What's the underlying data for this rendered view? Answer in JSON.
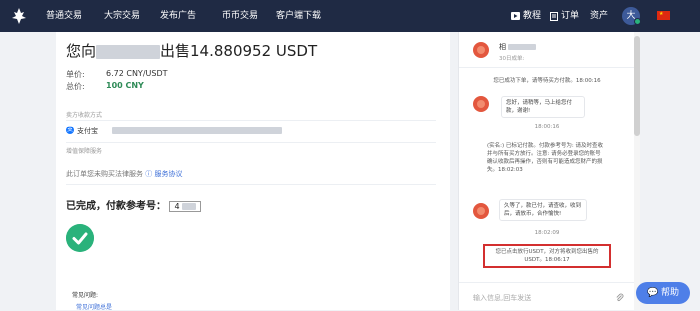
{
  "nav": {
    "items": [
      "普通交易",
      "大宗交易",
      "发布广告",
      "币币交易",
      "客户端下载"
    ],
    "right": {
      "tutorial": "教程",
      "orders": "订单",
      "assets": "资产"
    },
    "avatar_letter": "大",
    "accent": "#1f2a44"
  },
  "order": {
    "title_prefix": "您向",
    "title_suffix": "出售14.880952 USDT",
    "unit_price_label": "单价:",
    "unit_price_value": "6.72 CNY/USDT",
    "total_label": "总价:",
    "total_value": "100 CNY",
    "seller_payment_label": "卖方收款方式",
    "payment_method": "支付宝",
    "guarantee_label": "增值保障服务",
    "guarantee_text": "此订单您未购买法律服务",
    "service_agreement": "服务协议",
    "completed_label": "已完成，付款参考号：",
    "ref_number": "4",
    "faq_label": "常见问题:",
    "faq_link": "常见问题总是"
  },
  "chat": {
    "header_name": "相",
    "header_sub": "30日成单:",
    "msgs": [
      {
        "text": "您已成功下单，请等待买方付款。18:00:16"
      },
      {
        "text": "您好，请稍等，马上给您付款，谢谢!"
      },
      {
        "time": "18:00:16"
      },
      {
        "text": "(实名:) 已标记付款。付款参考号为: 请及时查收并与所有买方放行。注意: 请务必登录您的账号确认收款后再操作，否则有可能造成您财产的损失。18:02:03"
      },
      {
        "text": "久等了，款已付，请查收，收到后，请放币，合作愉快!"
      },
      {
        "time": "18:02:09"
      },
      {
        "text": "您已点击放行USDT，对方将收到您出售的USDT。18:06:17"
      }
    ],
    "input_placeholder": "输入信息,回车发送",
    "highlight_color": "#d32f2f"
  },
  "help_label": "帮助"
}
